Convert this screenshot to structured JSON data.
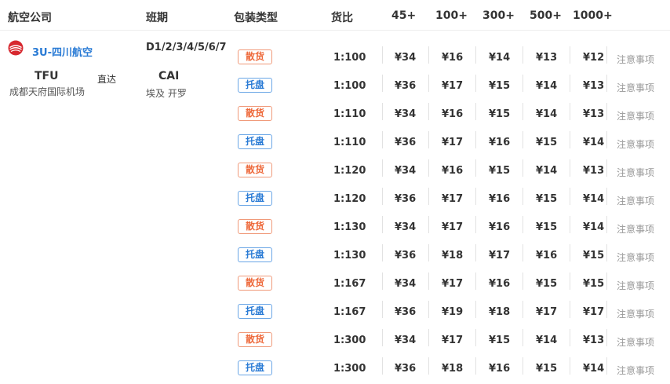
{
  "headers": {
    "airline": "航空公司",
    "schedule": "班期",
    "packaging": "包装类型",
    "ratio": "货比",
    "w45": "45+",
    "w100": "100+",
    "w300": "300+",
    "w500": "500+",
    "w1000": "1000+"
  },
  "route": {
    "airline_name": "3U-四川航空",
    "airline_logo_icon": "sichuan-airlines-logo-icon",
    "schedule_days": "D1/2/3/4/5/6/7",
    "origin_code": "TFU",
    "origin_name": "成都天府国际机场",
    "direct_label": "直达",
    "dest_code": "CAI",
    "dest_name": "埃及 开罗"
  },
  "colors": {
    "bulk": "#ee6a3c",
    "pallet": "#2a7bd5",
    "airline_link": "#2a7bd5"
  },
  "rows": [
    {
      "pkg": "散货",
      "type": "bulk",
      "ratio": "1:100",
      "p45": "¥34",
      "p100": "¥16",
      "p300": "¥14",
      "p500": "¥13",
      "p1000": "¥12",
      "note": "注意事项"
    },
    {
      "pkg": "托盘",
      "type": "pallet",
      "ratio": "1:100",
      "p45": "¥36",
      "p100": "¥17",
      "p300": "¥15",
      "p500": "¥14",
      "p1000": "¥13",
      "note": "注意事项"
    },
    {
      "pkg": "散货",
      "type": "bulk",
      "ratio": "1:110",
      "p45": "¥34",
      "p100": "¥16",
      "p300": "¥15",
      "p500": "¥14",
      "p1000": "¥13",
      "note": "注意事项"
    },
    {
      "pkg": "托盘",
      "type": "pallet",
      "ratio": "1:110",
      "p45": "¥36",
      "p100": "¥17",
      "p300": "¥16",
      "p500": "¥15",
      "p1000": "¥14",
      "note": "注意事项"
    },
    {
      "pkg": "散货",
      "type": "bulk",
      "ratio": "1:120",
      "p45": "¥34",
      "p100": "¥16",
      "p300": "¥15",
      "p500": "¥14",
      "p1000": "¥13",
      "note": "注意事项"
    },
    {
      "pkg": "托盘",
      "type": "pallet",
      "ratio": "1:120",
      "p45": "¥36",
      "p100": "¥17",
      "p300": "¥16",
      "p500": "¥15",
      "p1000": "¥14",
      "note": "注意事项"
    },
    {
      "pkg": "散货",
      "type": "bulk",
      "ratio": "1:130",
      "p45": "¥34",
      "p100": "¥17",
      "p300": "¥16",
      "p500": "¥15",
      "p1000": "¥14",
      "note": "注意事项"
    },
    {
      "pkg": "托盘",
      "type": "pallet",
      "ratio": "1:130",
      "p45": "¥36",
      "p100": "¥18",
      "p300": "¥17",
      "p500": "¥16",
      "p1000": "¥15",
      "note": "注意事项"
    },
    {
      "pkg": "散货",
      "type": "bulk",
      "ratio": "1:167",
      "p45": "¥34",
      "p100": "¥17",
      "p300": "¥16",
      "p500": "¥15",
      "p1000": "¥15",
      "note": "注意事项"
    },
    {
      "pkg": "托盘",
      "type": "pallet",
      "ratio": "1:167",
      "p45": "¥36",
      "p100": "¥19",
      "p300": "¥18",
      "p500": "¥17",
      "p1000": "¥17",
      "note": "注意事项"
    },
    {
      "pkg": "散货",
      "type": "bulk",
      "ratio": "1:300",
      "p45": "¥34",
      "p100": "¥17",
      "p300": "¥15",
      "p500": "¥14",
      "p1000": "¥13",
      "note": "注意事项"
    },
    {
      "pkg": "托盘",
      "type": "pallet",
      "ratio": "1:300",
      "p45": "¥36",
      "p100": "¥18",
      "p300": "¥16",
      "p500": "¥15",
      "p1000": "¥14",
      "note": "注意事项"
    }
  ]
}
